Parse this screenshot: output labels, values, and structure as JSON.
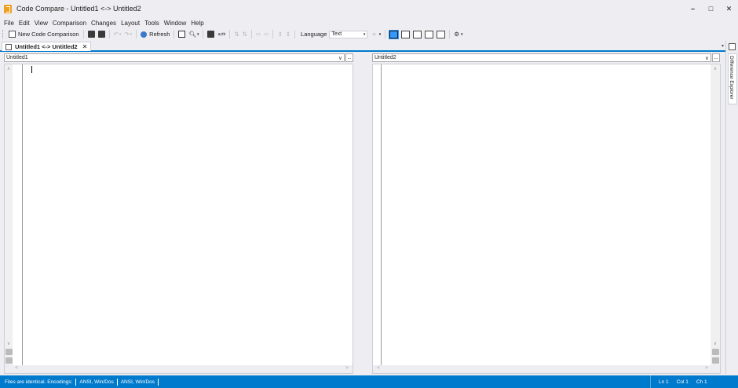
{
  "window": {
    "title": "Code Compare - Untitled1 <-> Untitled2",
    "minimize": "–",
    "maximize": "□",
    "close": "✕"
  },
  "menu": [
    "File",
    "Edit",
    "View",
    "Comparison",
    "Changes",
    "Layout",
    "Tools",
    "Window",
    "Help"
  ],
  "toolbar": {
    "new_comparison_label": "New Code Comparison",
    "refresh_label": "Refresh",
    "language_label": "Language",
    "language_value": "Text",
    "dropdown_arrow": "▾"
  },
  "tab": {
    "label": "Untitled1 <-> Untitled2",
    "close": "✕"
  },
  "left_pane": {
    "path_value": "Untitled1",
    "browse_label": "..."
  },
  "right_pane": {
    "path_value": "Untitled2",
    "browse_label": "..."
  },
  "side_panel": {
    "label": "Difference Explorer"
  },
  "status": {
    "message": "Files are identical. Encodings:",
    "encoding_left": "ANSI, Win/Dos",
    "encoding_right": "ANSI, Win/Dos",
    "line": "Ln 1",
    "col": "Col 1",
    "ch": "Ch 1"
  },
  "colors": {
    "accent": "#007acc",
    "chrome": "#eeeef2",
    "app_icon": "#f0a020"
  },
  "icons": [
    "app-icon",
    "new-comparison-icon",
    "open-icon",
    "save-icon",
    "undo-icon",
    "redo-icon",
    "refresh-icon",
    "find-icon",
    "layout-icon",
    "close-icon"
  ]
}
